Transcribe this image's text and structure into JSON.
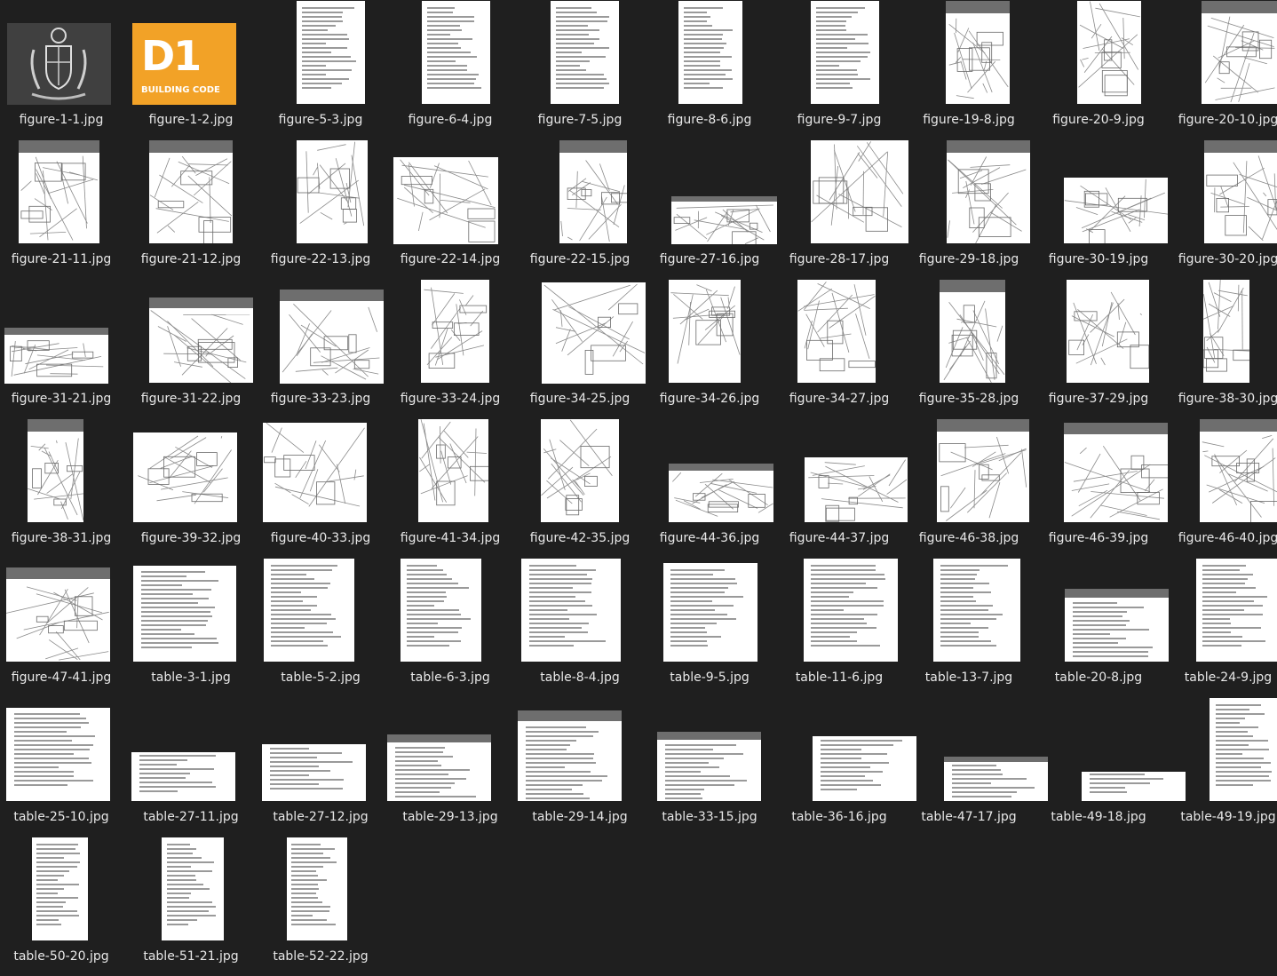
{
  "window": {
    "view": "large-icons"
  },
  "files": [
    {
      "name": "figure-1-1.jpg",
      "thumb": "coat-of-arms"
    },
    {
      "name": "figure-1-2.jpg",
      "thumb": "d1-logo",
      "logo_text": "D1",
      "logo_subtext": "BUILDING CODE"
    },
    {
      "name": "figure-5-3.jpg",
      "thumb": "text-page"
    },
    {
      "name": "figure-6-4.jpg",
      "thumb": "text-page"
    },
    {
      "name": "figure-7-5.jpg",
      "thumb": "text-page"
    },
    {
      "name": "figure-8-6.jpg",
      "thumb": "text-page"
    },
    {
      "name": "figure-9-7.jpg",
      "thumb": "text-page"
    },
    {
      "name": "figure-19-8.jpg",
      "thumb": "drawing"
    },
    {
      "name": "figure-20-9.jpg",
      "thumb": "drawing"
    },
    {
      "name": "figure-20-10.jpg",
      "thumb": "drawing"
    },
    {
      "name": "figure-21-11.jpg",
      "thumb": "drawing"
    },
    {
      "name": "figure-21-12.jpg",
      "thumb": "drawing"
    },
    {
      "name": "figure-22-13.jpg",
      "thumb": "drawing"
    },
    {
      "name": "figure-22-14.jpg",
      "thumb": "drawing"
    },
    {
      "name": "figure-22-15.jpg",
      "thumb": "drawing"
    },
    {
      "name": "figure-27-16.jpg",
      "thumb": "drawing"
    },
    {
      "name": "figure-28-17.jpg",
      "thumb": "drawing"
    },
    {
      "name": "figure-29-18.jpg",
      "thumb": "drawing"
    },
    {
      "name": "figure-30-19.jpg",
      "thumb": "drawing"
    },
    {
      "name": "figure-30-20.jpg",
      "thumb": "drawing"
    },
    {
      "name": "figure-31-21.jpg",
      "thumb": "drawing"
    },
    {
      "name": "figure-31-22.jpg",
      "thumb": "drawing"
    },
    {
      "name": "figure-33-23.jpg",
      "thumb": "drawing"
    },
    {
      "name": "figure-33-24.jpg",
      "thumb": "drawing"
    },
    {
      "name": "figure-34-25.jpg",
      "thumb": "drawing"
    },
    {
      "name": "figure-34-26.jpg",
      "thumb": "drawing"
    },
    {
      "name": "figure-34-27.jpg",
      "thumb": "drawing"
    },
    {
      "name": "figure-35-28.jpg",
      "thumb": "drawing"
    },
    {
      "name": "figure-37-29.jpg",
      "thumb": "drawing"
    },
    {
      "name": "figure-38-30.jpg",
      "thumb": "drawing"
    },
    {
      "name": "figure-38-31.jpg",
      "thumb": "drawing"
    },
    {
      "name": "figure-39-32.jpg",
      "thumb": "drawing"
    },
    {
      "name": "figure-40-33.jpg",
      "thumb": "drawing"
    },
    {
      "name": "figure-41-34.jpg",
      "thumb": "drawing"
    },
    {
      "name": "figure-42-35.jpg",
      "thumb": "drawing"
    },
    {
      "name": "figure-44-36.jpg",
      "thumb": "drawing"
    },
    {
      "name": "figure-44-37.jpg",
      "thumb": "drawing"
    },
    {
      "name": "figure-46-38.jpg",
      "thumb": "drawing"
    },
    {
      "name": "figure-46-39.jpg",
      "thumb": "drawing"
    },
    {
      "name": "figure-46-40.jpg",
      "thumb": "drawing"
    },
    {
      "name": "figure-47-41.jpg",
      "thumb": "drawing"
    },
    {
      "name": "table-3-1.jpg",
      "thumb": "table"
    },
    {
      "name": "table-5-2.jpg",
      "thumb": "text-page"
    },
    {
      "name": "table-6-3.jpg",
      "thumb": "text-page"
    },
    {
      "name": "table-8-4.jpg",
      "thumb": "text-page"
    },
    {
      "name": "table-9-5.jpg",
      "thumb": "text-page"
    },
    {
      "name": "table-11-6.jpg",
      "thumb": "table"
    },
    {
      "name": "table-13-7.jpg",
      "thumb": "table"
    },
    {
      "name": "table-20-8.jpg",
      "thumb": "table"
    },
    {
      "name": "table-24-9.jpg",
      "thumb": "table"
    },
    {
      "name": "table-25-10.jpg",
      "thumb": "table"
    },
    {
      "name": "table-27-11.jpg",
      "thumb": "table"
    },
    {
      "name": "table-27-12.jpg",
      "thumb": "table"
    },
    {
      "name": "table-29-13.jpg",
      "thumb": "table"
    },
    {
      "name": "table-29-14.jpg",
      "thumb": "table"
    },
    {
      "name": "table-33-15.jpg",
      "thumb": "table"
    },
    {
      "name": "table-36-16.jpg",
      "thumb": "table"
    },
    {
      "name": "table-47-17.jpg",
      "thumb": "table"
    },
    {
      "name": "table-49-18.jpg",
      "thumb": "table"
    },
    {
      "name": "table-49-19.jpg",
      "thumb": "table"
    },
    {
      "name": "table-50-20.jpg",
      "thumb": "table"
    },
    {
      "name": "table-51-21.jpg",
      "thumb": "table"
    },
    {
      "name": "table-52-22.jpg",
      "thumb": "table"
    }
  ]
}
